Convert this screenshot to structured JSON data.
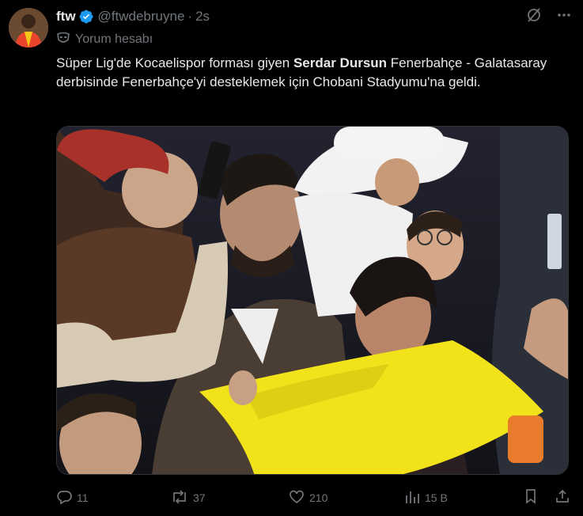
{
  "author": {
    "name": "ftw",
    "handle": "@ftwdebruyne",
    "time": "2s",
    "label": "Yorum hesabı",
    "avatar_icon": "player-avatar",
    "verified_color": "#1d9bf0"
  },
  "tweet": {
    "text_before": "Süper Lig'de Kocaelispor forması giyen ",
    "text_bold": "Serdar Dursun",
    "text_after": " Fenerbahçe - Galatasaray derbisinde Fenerbahçe'yi desteklemek için Chobani Stadyumu'na geldi."
  },
  "actions": {
    "replies": "11",
    "retweets": "37",
    "likes": "210",
    "views": "15 B"
  },
  "colors": {
    "background": "#000000",
    "text": "#e7e9ea",
    "muted": "#71767b",
    "accent": "#1d9bf0"
  }
}
